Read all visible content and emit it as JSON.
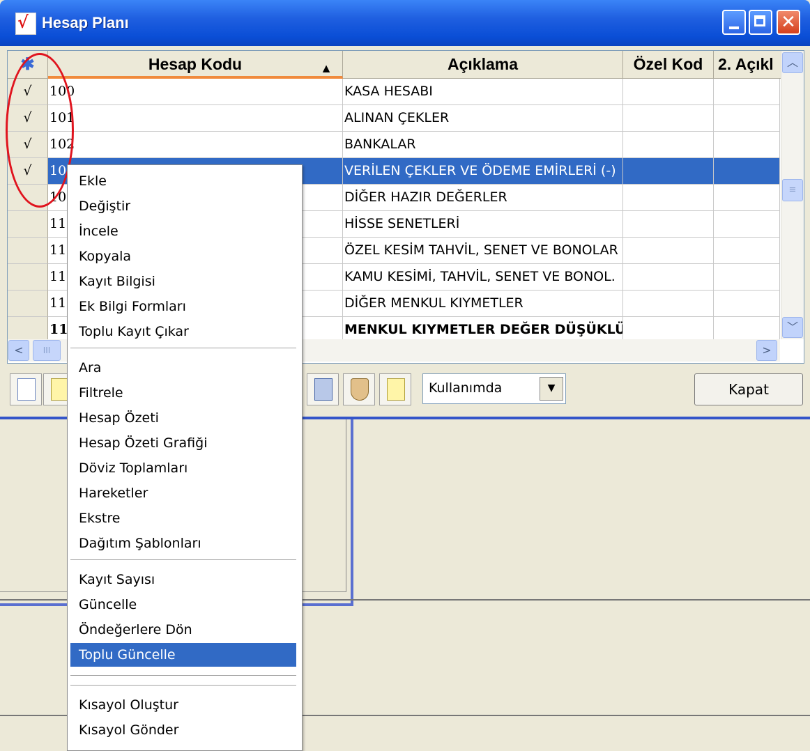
{
  "window": {
    "title": "Hesap Planı"
  },
  "grid": {
    "columns": [
      "Hesap Kodu",
      "Açıklama",
      "Özel Kod",
      "2. Açıkl"
    ],
    "rows": [
      {
        "mark": "√",
        "code": "100",
        "desc": "KASA HESABI"
      },
      {
        "mark": "√",
        "code": "101",
        "desc": "ALINAN ÇEKLER"
      },
      {
        "mark": "√",
        "code": "102",
        "desc": "BANKALAR"
      },
      {
        "mark": "√",
        "code": "10",
        "desc": "VERİLEN ÇEKLER VE ÖDEME EMİRLERİ (-)"
      },
      {
        "mark": "",
        "code": "10",
        "desc": "DİĞER HAZIR DEĞERLER"
      },
      {
        "mark": "",
        "code": "11",
        "desc": "HİSSE SENETLERİ"
      },
      {
        "mark": "",
        "code": "11",
        "desc": "ÖZEL KESİM TAHVİL, SENET VE BONOLAR"
      },
      {
        "mark": "",
        "code": "11",
        "desc": "KAMU KESİMİ, TAHVİL, SENET VE BONOL."
      },
      {
        "mark": "",
        "code": "11",
        "desc": "DİĞER MENKUL KIYMETLER"
      },
      {
        "mark": "",
        "code": "11",
        "desc": "MENKUL KIYMETLER DEĞER DÜŞÜKLÜ"
      }
    ],
    "selected_row": 3
  },
  "toolbar": {
    "status_combo": "Kullanımda",
    "close_label": "Kapat"
  },
  "menu": {
    "items": [
      "Ekle",
      "Değiştir",
      "İncele",
      "Kopyala",
      "Kayıt Bilgisi",
      "Ek Bilgi Formları",
      "Toplu Kayıt Çıkar",
      "Ara",
      "Filtrele",
      "Hesap Özeti",
      "Hesap Özeti Grafiği",
      "Döviz Toplamları",
      "Hareketler",
      "Ekstre",
      "Dağıtım Şablonları",
      "Kayıt Sayısı",
      "Güncelle",
      "Öndeğerlere Dön",
      "Toplu Güncelle",
      "Kısayol Oluştur",
      "Kısayol Gönder"
    ],
    "highlighted": "Toplu Güncelle"
  },
  "colors": {
    "selection": "#316ac5",
    "titlebar": "#0a4ed6",
    "annotation": "#e0141e"
  }
}
